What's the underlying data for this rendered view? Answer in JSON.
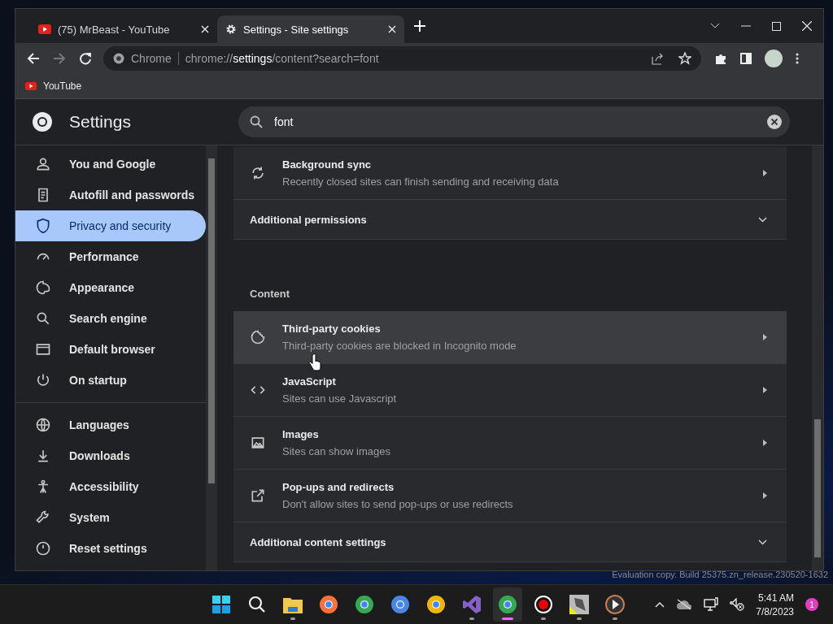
{
  "tabs": [
    {
      "title": "(75) MrBeast - YouTube",
      "selected": false
    },
    {
      "title": "Settings - Site settings",
      "selected": true
    }
  ],
  "toolbar": {
    "site_label": "Chrome",
    "address_host": "chrome://",
    "address_bold": "settings",
    "address_rest": "/content?search=font"
  },
  "bookmarks": [
    {
      "label": "YouTube"
    }
  ],
  "settings": {
    "title": "Settings",
    "search_value": "font"
  },
  "sidebar": {
    "groups": [
      [
        {
          "label": "You and Google",
          "selected": false
        },
        {
          "label": "Autofill and passwords",
          "selected": false
        },
        {
          "label": "Privacy and security",
          "selected": true
        },
        {
          "label": "Performance",
          "selected": false
        },
        {
          "label": "Appearance",
          "selected": false
        },
        {
          "label": "Search engine",
          "selected": false
        },
        {
          "label": "Default browser",
          "selected": false
        },
        {
          "label": "On startup",
          "selected": false
        }
      ],
      [
        {
          "label": "Languages",
          "selected": false
        },
        {
          "label": "Downloads",
          "selected": false
        },
        {
          "label": "Accessibility",
          "selected": false
        },
        {
          "label": "System",
          "selected": false
        },
        {
          "label": "Reset settings",
          "selected": false
        }
      ]
    ]
  },
  "content": [
    {
      "kind": "row",
      "title": "Background sync",
      "subtitle": "Recently closed sites can finish sending and receiving data",
      "hovered": false
    },
    {
      "kind": "expand",
      "title": "Additional permissions"
    },
    {
      "kind": "heading",
      "title": "Content"
    },
    {
      "kind": "row",
      "title": "Third-party cookies",
      "subtitle": "Third-party cookies are blocked in Incognito mode",
      "hovered": true
    },
    {
      "kind": "row",
      "title": "JavaScript",
      "subtitle": "Sites can use Javascript",
      "hovered": false
    },
    {
      "kind": "row",
      "title": "Images",
      "subtitle": "Sites can show images",
      "hovered": false
    },
    {
      "kind": "row",
      "title": "Pop-ups and redirects",
      "subtitle": "Don't allow sites to send pop-ups or use redirects",
      "hovered": false
    },
    {
      "kind": "expand",
      "title": "Additional content settings"
    }
  ],
  "desktop": {
    "watermark": "Evaluation copy. Build 25375.zn_release.230520-1632"
  },
  "taskbar": {
    "apps": [
      {
        "kind": "start",
        "active": false,
        "running": false
      },
      {
        "kind": "search",
        "active": false,
        "running": false
      },
      {
        "kind": "folder",
        "active": false,
        "running": true
      },
      {
        "kind": "firefox",
        "active": false,
        "running": false
      },
      {
        "kind": "chrome",
        "active": false,
        "running": false
      },
      {
        "kind": "chromium",
        "active": false,
        "running": false
      },
      {
        "kind": "canary",
        "active": false,
        "running": false
      },
      {
        "kind": "vs",
        "active": false,
        "running": true
      },
      {
        "kind": "chrome",
        "active": true,
        "running": true
      },
      {
        "kind": "record",
        "active": false,
        "running": true
      },
      {
        "kind": "picture",
        "active": false,
        "running": true
      },
      {
        "kind": "play",
        "active": false,
        "running": true
      }
    ],
    "time": "5:41 AM",
    "date": "7/8/2023",
    "notifications": "1"
  }
}
